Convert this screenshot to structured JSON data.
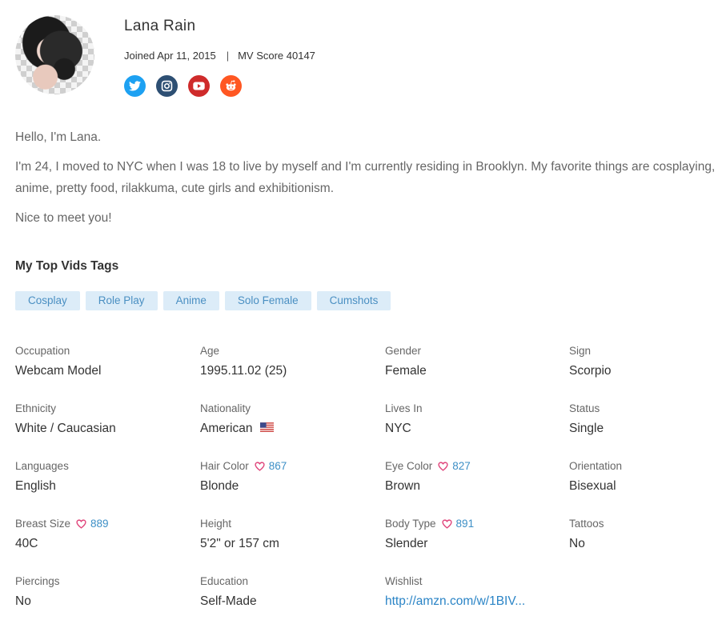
{
  "profile": {
    "name": "Lana Rain",
    "joined": "Joined Apr 11, 2015",
    "separator": "|",
    "score": "MV Score 40147",
    "social": [
      {
        "network": "twitter",
        "icon": "twitter-icon",
        "color": "#1da1f2"
      },
      {
        "network": "instagram",
        "icon": "instagram-icon",
        "color": "#2d4f73"
      },
      {
        "network": "youtube",
        "icon": "youtube-icon",
        "color": "#cf2b2b"
      },
      {
        "network": "reddit",
        "icon": "reddit-icon",
        "color": "#ff5722"
      }
    ]
  },
  "bio": [
    "Hello, I'm Lana.",
    "I'm 24, I moved to NYC when I was 18 to live by myself and I'm currently residing in Brooklyn. My favorite things are cosplaying, anime, pretty food, rilakkuma, cute girls and exhibitionism.",
    "Nice to meet you!"
  ],
  "tags": {
    "title": "My Top Vids Tags",
    "items": [
      "Cosplay",
      "Role Play",
      "Anime",
      "Solo Female",
      "Cumshots"
    ]
  },
  "details": [
    {
      "label": "Occupation",
      "value": "Webcam Model"
    },
    {
      "label": "Age",
      "value": "1995.11.02 (25)"
    },
    {
      "label": "Gender",
      "value": "Female"
    },
    {
      "label": "Sign",
      "value": "Scorpio"
    },
    {
      "label": "Ethnicity",
      "value": "White / Caucasian"
    },
    {
      "label": "Nationality",
      "value": "American",
      "flag": "us-flag-icon"
    },
    {
      "label": "Lives In",
      "value": "NYC"
    },
    {
      "label": "Status",
      "value": "Single"
    },
    {
      "label": "Languages",
      "value": "English"
    },
    {
      "label": "Hair Color",
      "value": "Blonde",
      "likes": "867"
    },
    {
      "label": "Eye Color",
      "value": "Brown",
      "likes": "827"
    },
    {
      "label": "Orientation",
      "value": "Bisexual"
    },
    {
      "label": "Breast Size",
      "value": "40C",
      "likes": "889"
    },
    {
      "label": "Height",
      "value": "5'2\" or 157 cm"
    },
    {
      "label": "Body Type",
      "value": "Slender",
      "likes": "891"
    },
    {
      "label": "Tattoos",
      "value": "No"
    },
    {
      "label": "Piercings",
      "value": "No"
    },
    {
      "label": "Education",
      "value": "Self-Made"
    },
    {
      "label": "Wishlist",
      "value": "http://amzn.com/w/1BIV...",
      "link": true
    }
  ],
  "colors": {
    "heart": "#e0457b",
    "count": "#3d8fc6",
    "tag_bg": "#dcecf8",
    "tag_text": "#4a8fc2",
    "link": "#2a84c6"
  }
}
